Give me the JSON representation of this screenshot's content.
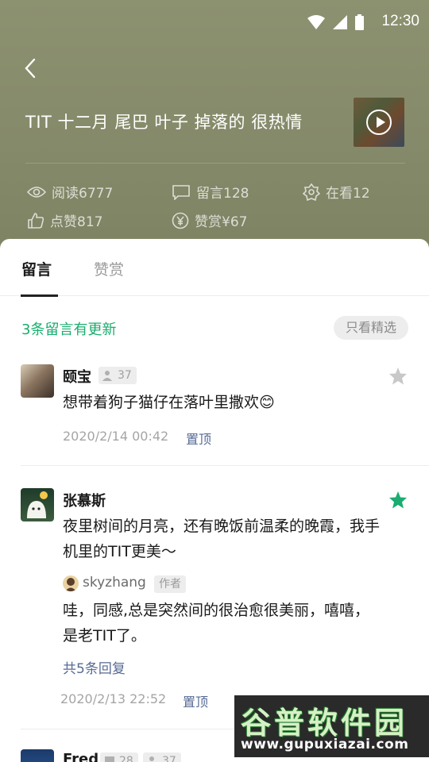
{
  "status_bar": {
    "time": "12:30"
  },
  "article": {
    "title": "TIT 十二月 尾巴 叶子 掉落的 很热情"
  },
  "stats": {
    "read": "阅读6777",
    "comments": "留言128",
    "watching": "在看12",
    "likes": "点赞817",
    "reward": "赞赏¥67"
  },
  "tabs": {
    "comments": "留言",
    "rewards": "赞赏"
  },
  "updates_label": "3条留言有更新",
  "filter_label": "只看精选",
  "comments": [
    {
      "name": "颐宝",
      "badge": "37",
      "text": "想带着狗子猫仔在落叶里撒欢😊",
      "date": "2020/2/14 00:42",
      "pin": "置顶",
      "starred": false
    },
    {
      "name": "张慕斯",
      "text": "夜里树间的月亮，还有晚饭前温柔的晚霞，我手机里的TIT更美～",
      "reply": {
        "name": "skyzhang",
        "role": "作者",
        "text": "哇，同感,总是突然间的很治愈很美丽，嘻嘻，是老TIT了。"
      },
      "more_replies": "共5条回复",
      "date": "2020/2/13 22:52",
      "pin": "置顶",
      "starred": true
    },
    {
      "name": "Fred",
      "badge_comments": "28",
      "badge_users": "37"
    }
  ],
  "watermark": {
    "title": "谷普软件园",
    "url": "www.gupuxiazai.com"
  },
  "colors": {
    "header": "#878c6b",
    "accent_green": "#1aad6f",
    "link_blue": "#576b95"
  }
}
